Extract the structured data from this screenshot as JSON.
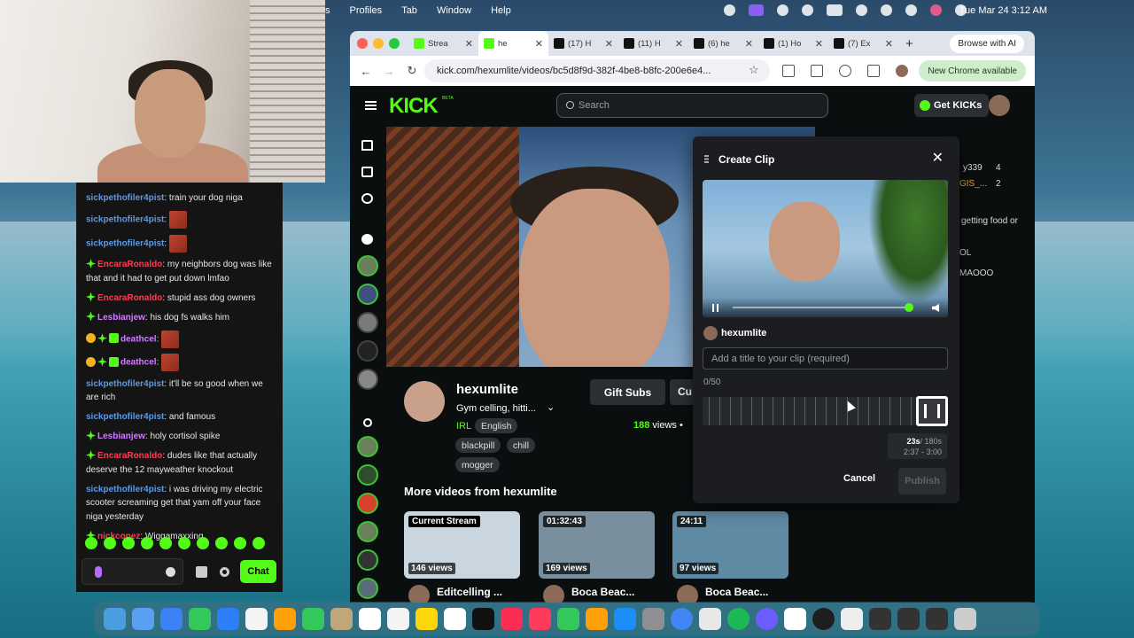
{
  "menubar": {
    "items": [
      "s",
      "Profiles",
      "Tab",
      "Window",
      "Help"
    ],
    "clock": "Tue Mar 24  3:12 AM"
  },
  "chat": {
    "messages": [
      {
        "user": "sickpethofiler4pist",
        "color": "u1",
        "text": "train your dog niga",
        "badges": []
      },
      {
        "user": "sickpethofiler4pist",
        "color": "u1",
        "text": "",
        "emote": true,
        "badges": []
      },
      {
        "user": "sickpethofiler4pist",
        "color": "u1",
        "text": "",
        "emote": true,
        "badges": []
      },
      {
        "user": "EncaraRonaldo",
        "color": "u2",
        "text": "my neighbors dog was like that and it had to get put down lmfao",
        "badges": [
          "spark"
        ]
      },
      {
        "user": "EncaraRonaldo",
        "color": "u2",
        "text": "stupid ass dog owners",
        "badges": [
          "spark"
        ]
      },
      {
        "user": "Lesbianjew",
        "color": "u3",
        "text": "his dog fs walks him",
        "badges": [
          "spark"
        ]
      },
      {
        "user": "deathcel",
        "color": "u3",
        "text": "",
        "emote": true,
        "badges": [
          "gold",
          "spark",
          "sub"
        ]
      },
      {
        "user": "deathcel",
        "color": "u3",
        "text": "",
        "emote": true,
        "badges": [
          "gold",
          "spark",
          "sub"
        ]
      },
      {
        "user": "sickpethofiler4pist",
        "color": "u1",
        "text": "it'll be so good when we are rich",
        "badges": []
      },
      {
        "user": "sickpethofiler4pist",
        "color": "u1",
        "text": "and famous",
        "badges": []
      },
      {
        "user": "Lesbianjew",
        "color": "u3",
        "text": "holy cortisol spike",
        "badges": [
          "spark"
        ]
      },
      {
        "user": "EncaraRonaldo",
        "color": "u2",
        "text": "dudes like that actually deserve the 12 mayweather knockout",
        "badges": [
          "spark"
        ]
      },
      {
        "user": "sickpethofiler4pist",
        "color": "u1",
        "text": "i was driving my electric scooter screaming get that yam off your face niga yesterday",
        "badges": []
      },
      {
        "user": "nickconez",
        "color": "u2",
        "text": "Wiggamaxxing",
        "badges": [
          "spark"
        ]
      }
    ],
    "send_label": "Chat"
  },
  "browser": {
    "tabs": [
      {
        "title": "Strea",
        "fav": "k",
        "active": false
      },
      {
        "title": "he",
        "fav": "k",
        "active": true
      },
      {
        "title": "(17) H",
        "fav": "x",
        "active": false
      },
      {
        "title": "(11) H",
        "fav": "x",
        "active": false
      },
      {
        "title": "(6) he",
        "fav": "x",
        "active": false
      },
      {
        "title": "(1) Ho",
        "fav": "x",
        "active": false
      },
      {
        "title": "(7) Ex",
        "fav": "x",
        "active": false
      }
    ],
    "browse_ai": "Browse with AI",
    "url": "kick.com/hexumlite/videos/bc5d8f9d-382f-4be8-b8fc-200e6e4...",
    "new_chrome": "New Chrome available"
  },
  "kick": {
    "logo": "KICK",
    "beta": "BETA",
    "search_placeholder": "Search",
    "get_kicks": "Get KICKs",
    "streamer": "hexumlite",
    "stream_title": "Gym celling, hitti...",
    "category": "IRL",
    "tags": [
      "English",
      "blackpill",
      "chill",
      "mogger"
    ],
    "gift_subs": "Gift Subs",
    "clip_btn_partial": "Cu",
    "views_count": "188",
    "views_label": "views  •",
    "more_videos": "More videos from hexumlite",
    "thumbs": [
      {
        "top": "Current Stream",
        "views": "146 views",
        "title": "Editcelling ..."
      },
      {
        "top": "01:32:43",
        "views": "169 views",
        "title": "Boca Beac..."
      },
      {
        "top": "24:11",
        "views": "97 views",
        "title": "Boca Beac..."
      }
    ],
    "side_snippets": [
      "y339",
      "4",
      "GIS_...",
      "2",
      "getting food or",
      "OL",
      "MAOOO"
    ]
  },
  "clip": {
    "title": "Create Clip",
    "clipper": "hexumlite",
    "title_placeholder": "Add a title to your clip (required)",
    "count": "0/50",
    "duration": "23s",
    "duration_max": "/ 180s",
    "range": "2:37 - 3:00",
    "cancel": "Cancel",
    "publish": "Publish"
  }
}
